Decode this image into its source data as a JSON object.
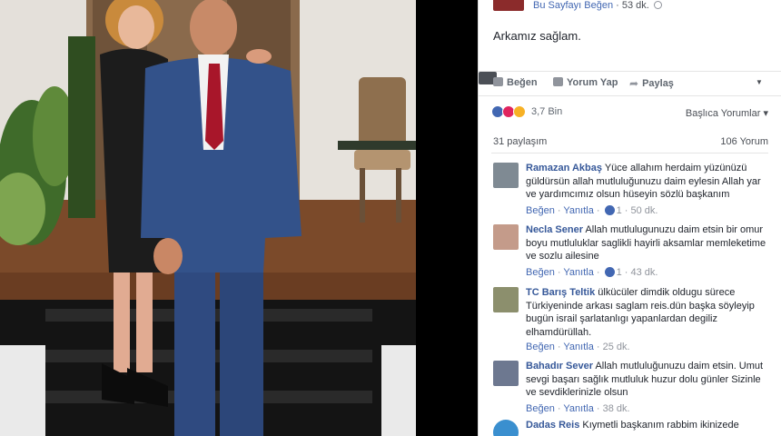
{
  "post_header": {
    "page_action": "Bu Sayfayı Beğen",
    "separator": "·",
    "time": "53 dk."
  },
  "post": {
    "text": "Arkamız sağlam."
  },
  "actions": {
    "like": "Beğen",
    "comment": "Yorum Yap",
    "share": "Paylaş"
  },
  "reactions": {
    "count": "3,7 Bin",
    "sort": "Başlıca Yorumlar",
    "sort_caret": "▾"
  },
  "stats": {
    "shares": "31 paylaşım",
    "comments": "106 Yorum"
  },
  "comments": [
    {
      "name": "Ramazan Akbaş",
      "text": "Yüce allahım herdaim yüzünüzü güldürsün allah mutluluğunuzu daim eylesin Allah yar ve yardımcımız olsun hüseyin sözlü başkanım",
      "like": "Beğen",
      "reply": "Yanıtla",
      "likes": "1",
      "time": "50 dk."
    },
    {
      "name": "Necla Sener",
      "text": "Allah mutlulugunuzu daim etsin bir omur boyu mutluluklar saglikli hayirli aksamlar memleketime ve sozlu ailesine",
      "like": "Beğen",
      "reply": "Yanıtla",
      "likes": "1",
      "time": "43 dk."
    },
    {
      "name": "TC Barış Teltik",
      "text": "ülkücüler dimdik oldugu sürece Türkiyeninde arkası saglam reis.dün başka söyleyip bugün israil şarlatanlıgı yapanlardan degiliz elhamdürüllah.",
      "like": "Beğen",
      "reply": "Yanıtla",
      "time": "25 dk."
    },
    {
      "name": "Bahadır Sever",
      "text": "Allah mutluluğunuzu daim etsin. Umut sevgi başarı sağlık mutluluk huzur dolu günler Sizinle ve sevdiklerinizle olsun",
      "like": "Beğen",
      "reply": "Yanıtla",
      "time": "38 dk."
    },
    {
      "name": "Dadas Reis",
      "text": "Kıymetli başkanım rabbim ikinizede"
    }
  ],
  "colors": {
    "link": "#365899",
    "accent": "#4267b2",
    "meta": "#90949c"
  }
}
